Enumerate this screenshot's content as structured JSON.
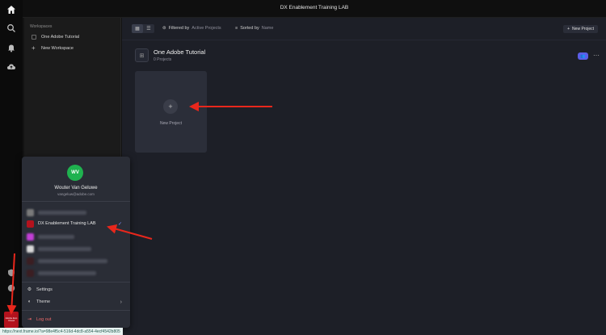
{
  "window": {
    "title": "DX Enablement Training LAB"
  },
  "rail": {
    "icons": [
      "home-icon",
      "search-icon",
      "bell-icon",
      "cloud-upload-icon",
      "shield-icon",
      "help-icon"
    ],
    "org_tile_text": "Adobe Exp Cloud"
  },
  "workspaces": {
    "heading": "Workspaces",
    "items": [
      {
        "label": "One Adobe Tutorial"
      },
      {
        "label": "New Workspace"
      }
    ]
  },
  "toolbar": {
    "filter_label": "Filtered by",
    "filter_value": "Active Projects",
    "sort_label": "Sorted by",
    "sort_value": "Name",
    "new_project_label": "New Project"
  },
  "workspace_view": {
    "name": "One Adobe Tutorial",
    "count": "0 Projects",
    "new_card_label": "New Project"
  },
  "account_popup": {
    "initials": "WV",
    "user_name": "Wouter Van Geluwe",
    "email": "vangeluw@adobe.com",
    "active_org": "DX Enablement Training LAB",
    "menu": {
      "settings": "Settings",
      "theme": "Theme",
      "logout": "Log out"
    }
  },
  "status_url": "https://next.frame.io/?a=98e4f5c4-516d-4dc8-a554-4ecf4542b805",
  "colors": {
    "accent": "#5b5ee8",
    "avatar_green": "#1fb24f",
    "annotation_red": "#e8271c",
    "logout_red": "#ef6a6a"
  }
}
